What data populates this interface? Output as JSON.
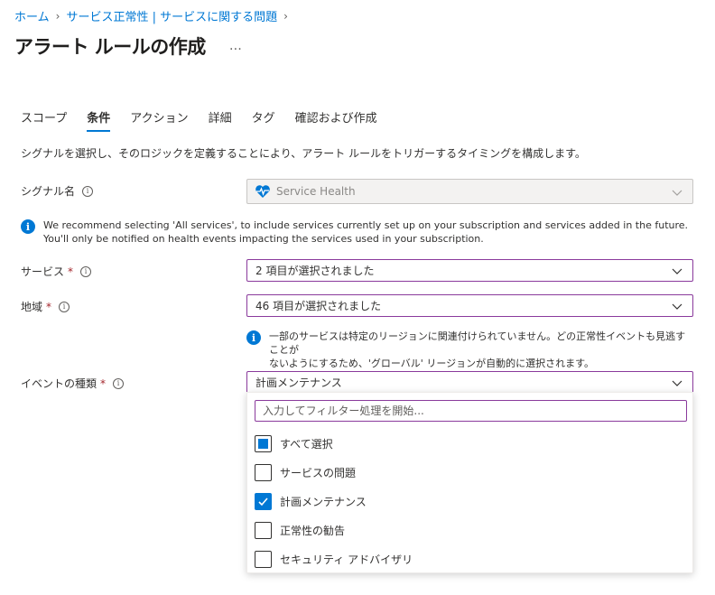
{
  "breadcrumb": {
    "home": "ホーム",
    "section": "サービス正常性 | サービスに関する問題"
  },
  "page": {
    "title": "アラート ルールの作成",
    "more": "…"
  },
  "tabs": [
    {
      "label": "スコープ",
      "active": false
    },
    {
      "label": "条件",
      "active": true
    },
    {
      "label": "アクション",
      "active": false
    },
    {
      "label": "詳細",
      "active": false
    },
    {
      "label": "タグ",
      "active": false
    },
    {
      "label": "確認および作成",
      "active": false
    }
  ],
  "description": "シグナルを選択し、そのロジックを定義することにより、アラート ルールをトリガーするタイミングを構成します。",
  "signal": {
    "label": "シグナル名",
    "value": "Service Health",
    "icon": "heart-pulse-icon"
  },
  "services_info": {
    "line1": "We recommend selecting 'All services', to include services currently set up on your subscription and services added in the future.",
    "line2": "You'll only be notified on health events impacting the services used in your subscription."
  },
  "services": {
    "label": "サービス",
    "required_mark": "*",
    "value": "2 項目が選択されました"
  },
  "region": {
    "label": "地域",
    "required_mark": "*",
    "value": "46 項目が選択されました"
  },
  "region_info": {
    "line1": "一部のサービスは特定のリージョンに関連付けられていません。どの正常性イベントも見逃すことが",
    "line2": "ないようにするため、'グローバル' リージョンが自動的に選択されます。"
  },
  "event_type": {
    "label": "イベントの種類",
    "required_mark": "*",
    "value": "計画メンテナンス"
  },
  "dropdown": {
    "filter_placeholder": "入力してフィルター処理を開始...",
    "options": [
      {
        "label": "すべて選択",
        "state": "partial"
      },
      {
        "label": "サービスの問題",
        "state": "unchecked"
      },
      {
        "label": "計画メンテナンス",
        "state": "checked"
      },
      {
        "label": "正常性の勧告",
        "state": "unchecked"
      },
      {
        "label": "セキュリティ アドバイザリ",
        "state": "unchecked"
      }
    ]
  },
  "colors": {
    "accent": "#0078d4",
    "focus_border": "#8a3a9c",
    "required": "#a4262c"
  }
}
